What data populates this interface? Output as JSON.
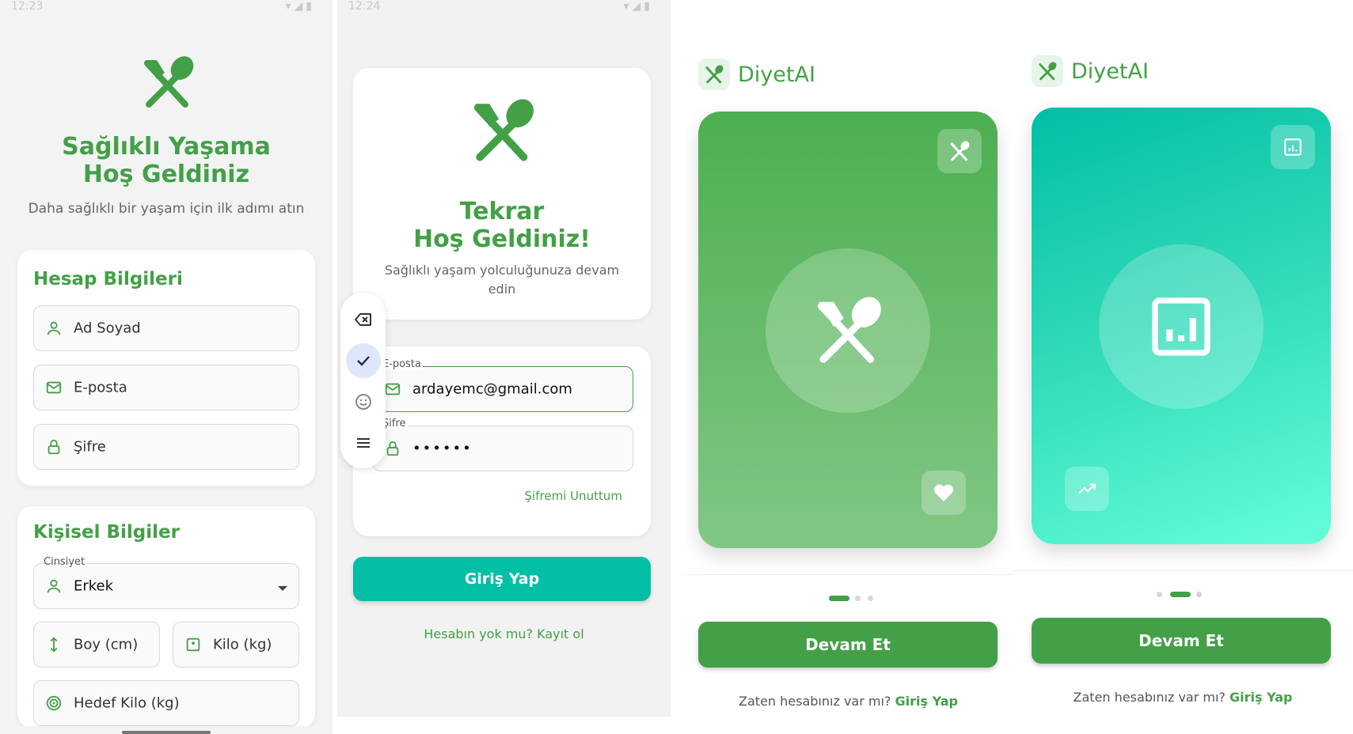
{
  "register": {
    "status_time": "12:23",
    "title_line1": "Sağlıklı Yaşama",
    "title_line2": "Hoş Geldiniz",
    "subtitle": "Daha sağlıklı bir yaşam için ilk adımı atın",
    "account_card": {
      "title": "Hesap Bilgileri",
      "fields": [
        {
          "label": "Ad Soyad",
          "icon": "person-icon"
        },
        {
          "label": "E-posta",
          "icon": "mail-icon"
        },
        {
          "label": "Şifre",
          "icon": "lock-icon"
        }
      ]
    },
    "personal_card": {
      "title": "Kişisel Bilgiler",
      "gender_label": "Cinsiyet",
      "gender_value": "Erkek",
      "height_label": "Boy (cm)",
      "weight_label": "Kilo (kg)",
      "target_label": "Hedef Kilo (kg)"
    }
  },
  "login": {
    "status_time": "12:24",
    "title_line1": "Tekrar",
    "title_line2": "Hoş Geldiniz!",
    "subtitle_line1": "Sağlıklı yaşam yolculuğunuza devam",
    "subtitle_line2": "edin",
    "email_label": "E-posta",
    "email_value": "ardayemc@gmail.com",
    "password_label": "Şifre",
    "password_value": "••••••",
    "forgot_link": "Şifremi Unuttum",
    "login_button": "Giriş Yap",
    "register_link": "Hesabın yok mu? Kayıt ol"
  },
  "onboarding": {
    "brand": "DiyetAI",
    "continue_button": "Devam Et",
    "have_account": "Zaten hesabınız var mı?",
    "login_link": "Giriş Yap",
    "page1_active_dot": 1,
    "page2_active_dot": 2
  },
  "colors": {
    "primary_green": "#43a047",
    "teal": "#00bfa5"
  }
}
